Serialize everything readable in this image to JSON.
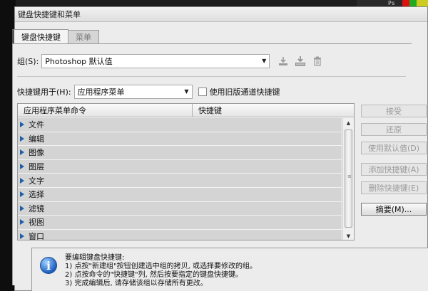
{
  "window": {
    "title": "键盘快捷键和菜单"
  },
  "corner_badge": "Ps",
  "tabs": [
    {
      "label": "键盘快捷键",
      "active": true
    },
    {
      "label": "菜单",
      "active": false
    }
  ],
  "set": {
    "label": "组(S):",
    "value": "Photoshop 默认值",
    "icons": [
      "save-set-icon",
      "new-set-icon",
      "delete-set-icon"
    ]
  },
  "shortcuts_for": {
    "label": "快捷键用于(H):",
    "value": "应用程序菜单",
    "legacy_checkbox_label": "使用旧版通道快捷键",
    "legacy_checked": false
  },
  "table": {
    "columns": [
      "应用程序菜单命令",
      "快捷键"
    ],
    "rows": [
      "文件",
      "编辑",
      "图像",
      "图层",
      "文字",
      "选择",
      "滤镜",
      "视图",
      "窗口"
    ]
  },
  "buttons": [
    {
      "label": "接受",
      "enabled": false
    },
    {
      "label": "还原",
      "enabled": false
    },
    {
      "label": "使用默认值(D)",
      "enabled": false
    },
    {
      "label": "添加快捷键(A)",
      "enabled": false
    },
    {
      "label": "删除快捷键(E)",
      "enabled": false
    },
    {
      "label": "摘要(M)...",
      "enabled": true
    }
  ],
  "info": {
    "lines": [
      "要编辑键盘快捷键:",
      "1) 点按\"新建组\"按钮创建选中组的拷贝, 或选择要修改的组。",
      "2) 点按命令的\"快捷键\"列, 然后按要指定的键盘快捷键。",
      "3) 完成编辑后, 请存储该组以存储所有更改。"
    ]
  },
  "colors": {
    "accent_triangle": "#1f5fa8",
    "row_bg": "#d4d4d4",
    "dialog_bg": "#ececec"
  }
}
